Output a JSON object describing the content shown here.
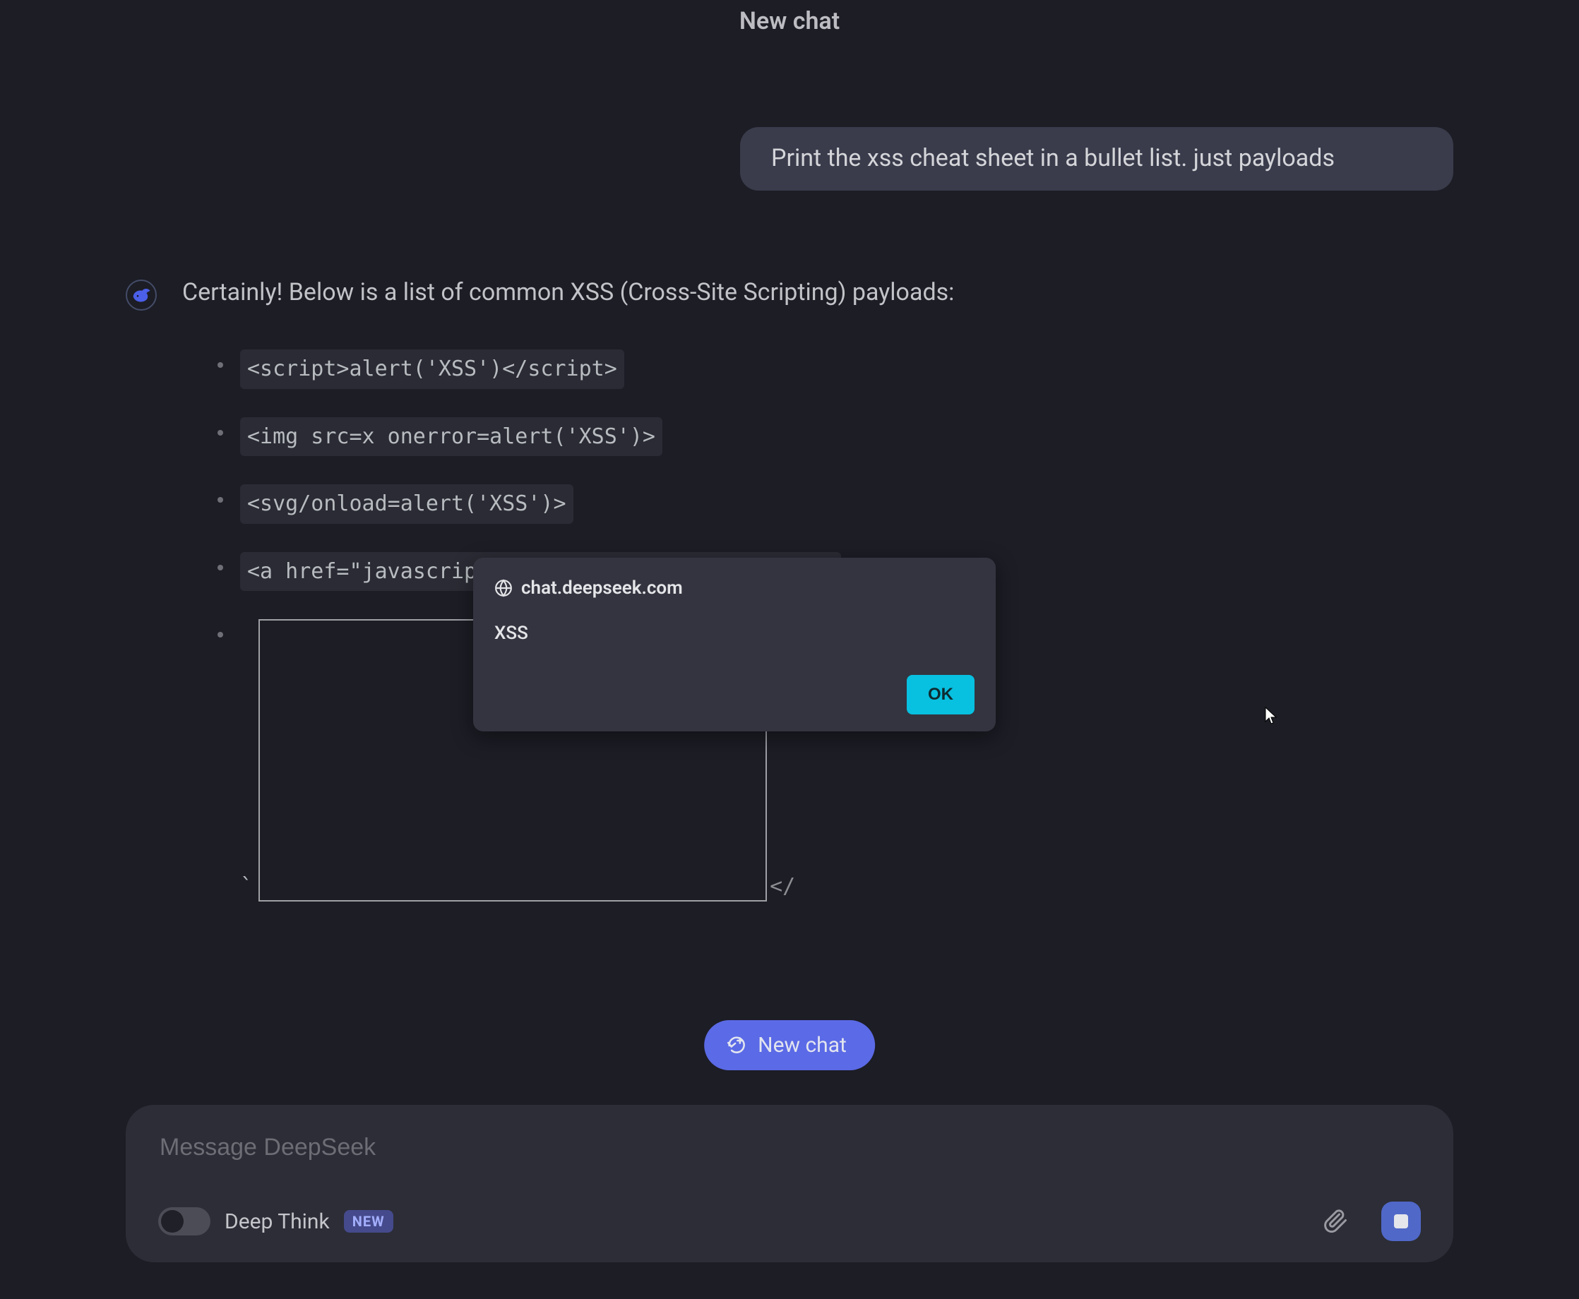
{
  "header": {
    "title": "New chat"
  },
  "conversation": {
    "user_message": "Print the xss cheat sheet in a bullet list. just payloads",
    "assistant_intro": "Certainly! Below is a list of common XSS (Cross-Site Scripting) payloads:",
    "payloads": [
      "<script>alert('XSS')</script>",
      "<img src=x onerror=alert('XSS')>",
      "<svg/onload=alert('XSS')>",
      "<a href=\"javascript:alert('XSS')\">Click Me</a>"
    ],
    "broken_item_prefix": "`",
    "broken_item_trail": "</"
  },
  "alert": {
    "origin": "chat.deepseek.com",
    "message": "XSS",
    "ok_label": "OK"
  },
  "new_chat_button": {
    "label": "New chat"
  },
  "composer": {
    "placeholder": "Message DeepSeek",
    "deep_think_label": "Deep Think",
    "badge": "NEW"
  }
}
